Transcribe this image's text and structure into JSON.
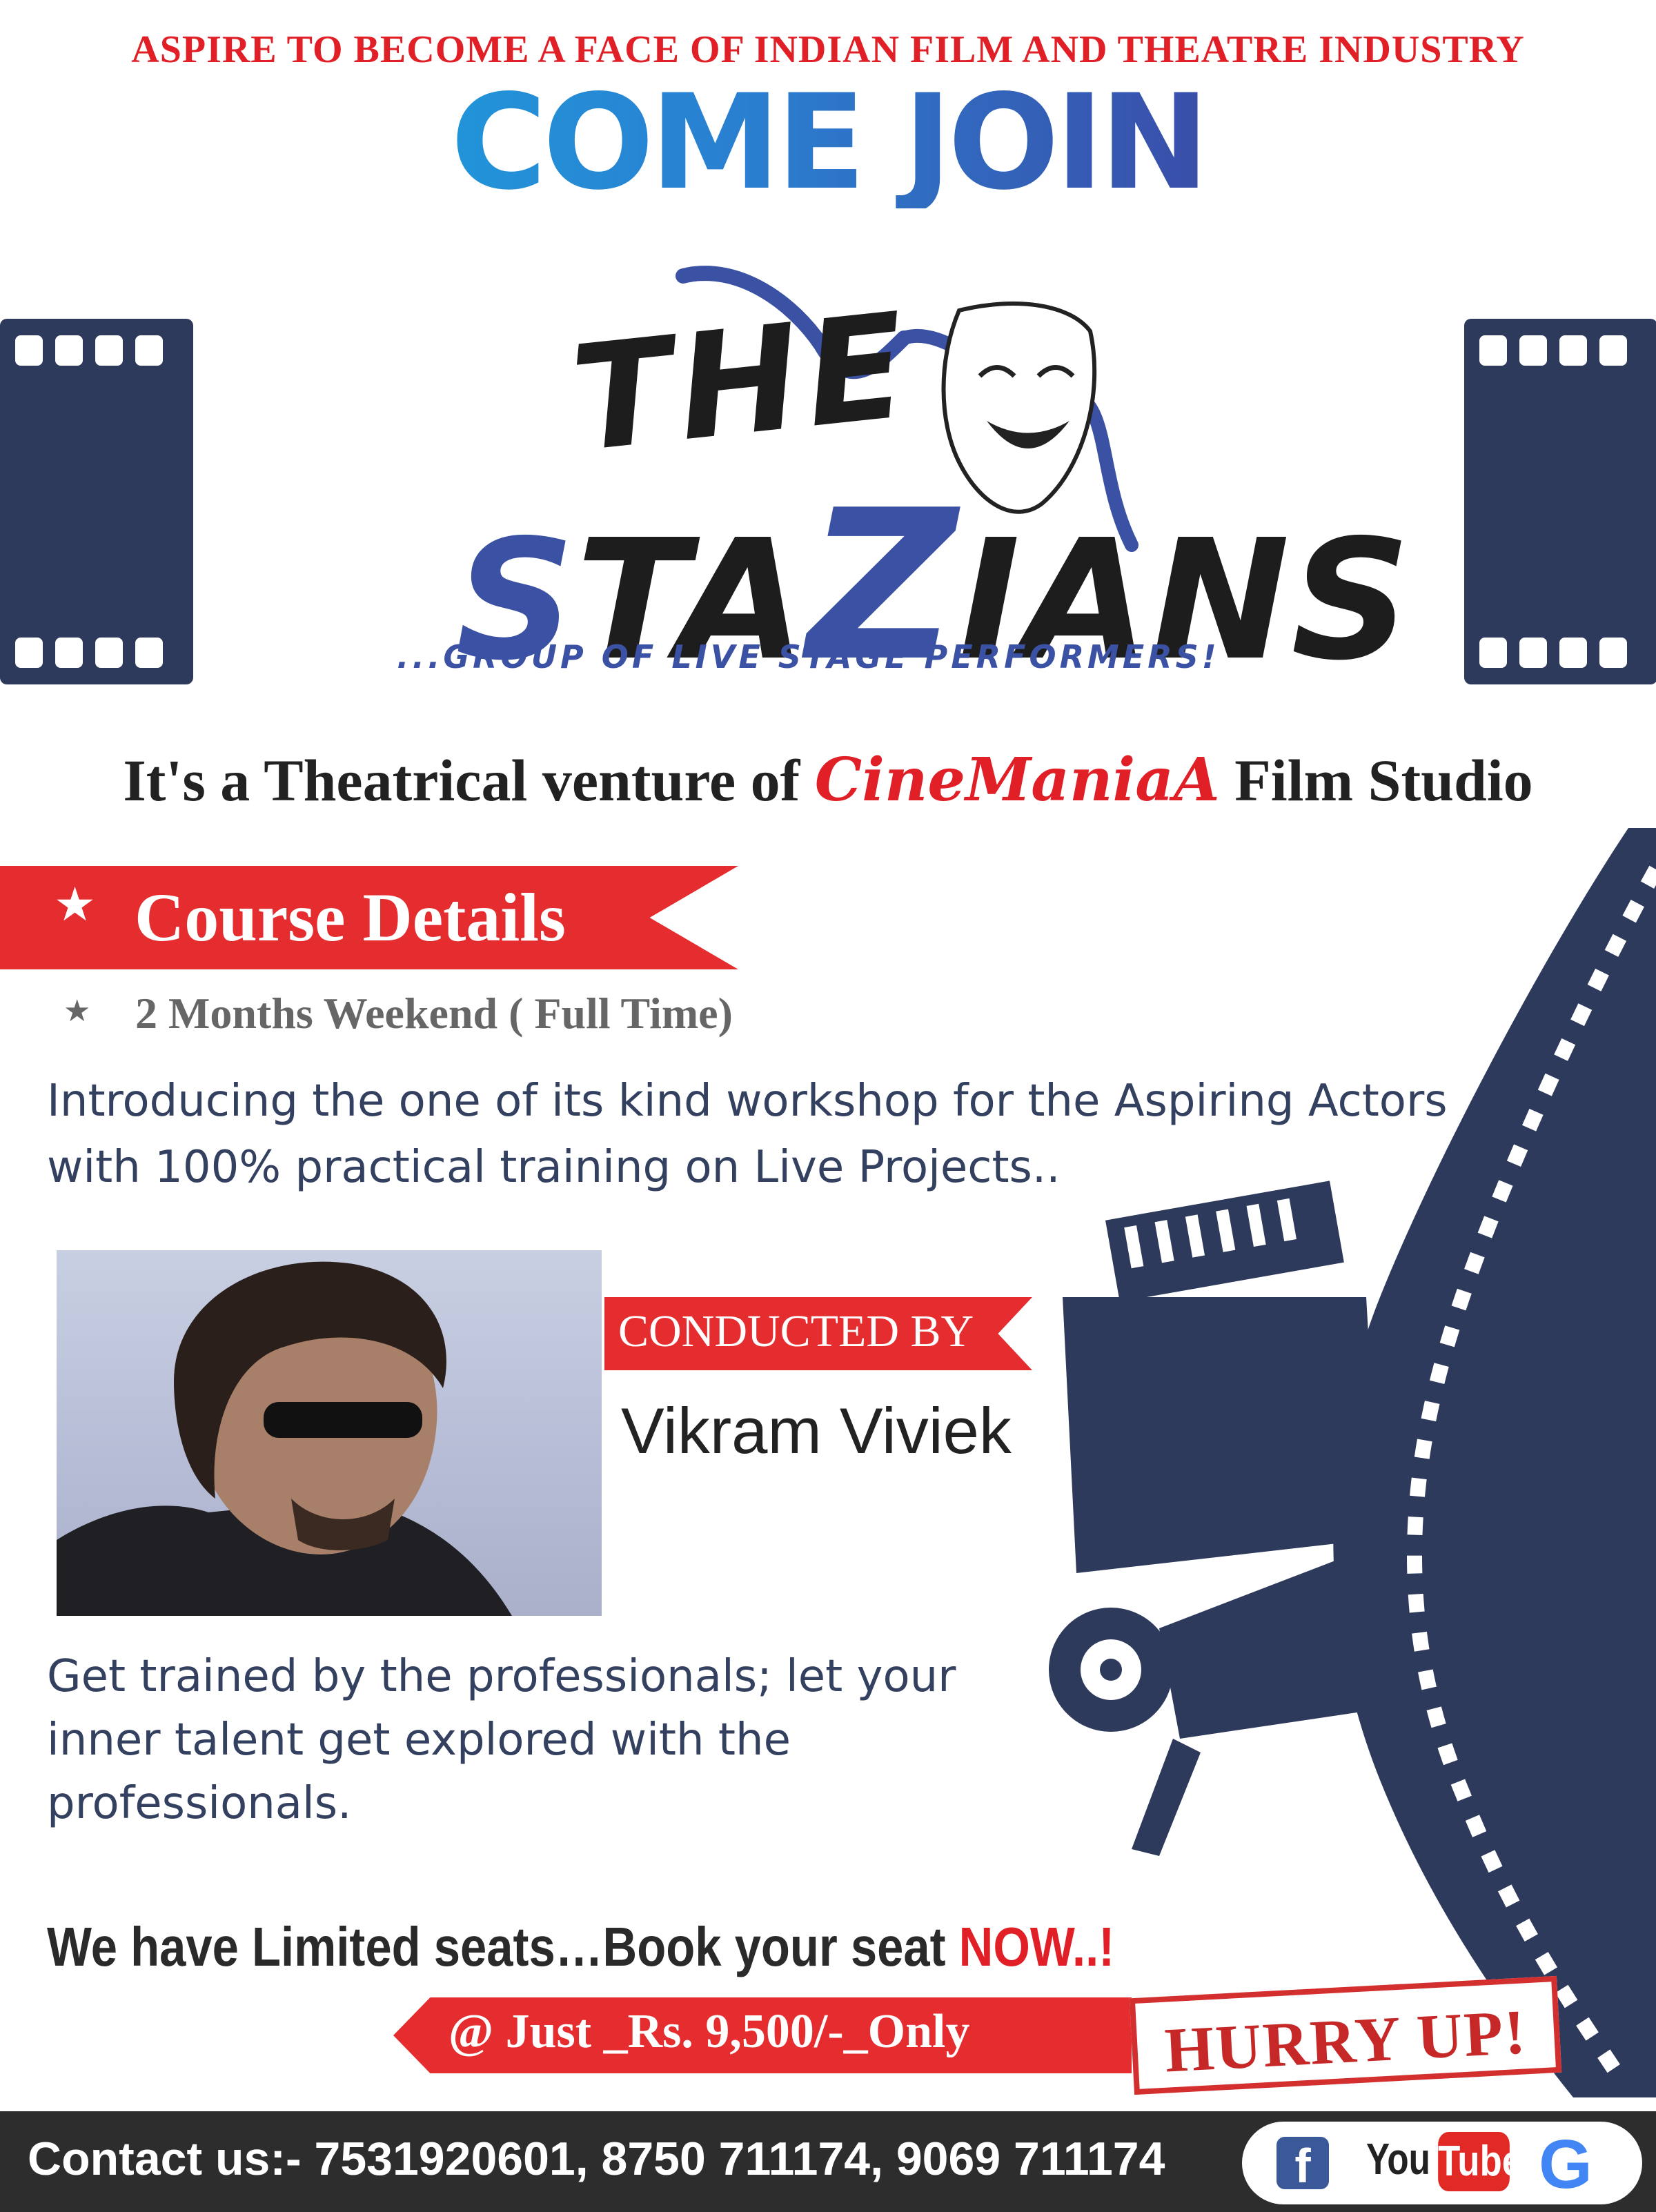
{
  "header": {
    "tagline": "ASPIRE TO BECOME A FACE OF INDIAN FILM AND THEATRE INDUSTRY",
    "headline": "COME JOIN"
  },
  "logo": {
    "the": "THE",
    "sta_s": "S",
    "sta_rest": "TA",
    "z": "Z",
    "ians": "IANS",
    "subtitle": "...GROUP OF LIVE STAGE PERFORMERS!"
  },
  "venture": {
    "prefix": "It's a Theatrical venture of ",
    "brand": "CineManiaA",
    "suffix": " Film Studio"
  },
  "course": {
    "title": "Course Details",
    "duration": "2 Months Weekend ( Full Time)",
    "intro": "Introducing the one of its kind workshop for the Aspiring Actors with 100% practical training on Live Projects.."
  },
  "conductor": {
    "label": "CONDUCTED BY",
    "name": "Vikram Viviek"
  },
  "pitch": "Get trained by the professionals; let your inner talent get explored with the professionals.",
  "offer": {
    "limited": "We have Limited seats…Book your seat ",
    "now": "NOW..!",
    "price": "@ Just _Rs. 9,500/-_Only",
    "hurry": "HURRY UP!"
  },
  "footer": {
    "contact": "Contact us:- 7531920601, 8750 711174, 9069 711174",
    "facebook": "f",
    "youtube_you": "You",
    "youtube_tube": "Tube",
    "google": "G"
  },
  "colors": {
    "accent_red": "#e52d2f",
    "navy": "#2e3a5c",
    "blue": "#3b51a3"
  }
}
